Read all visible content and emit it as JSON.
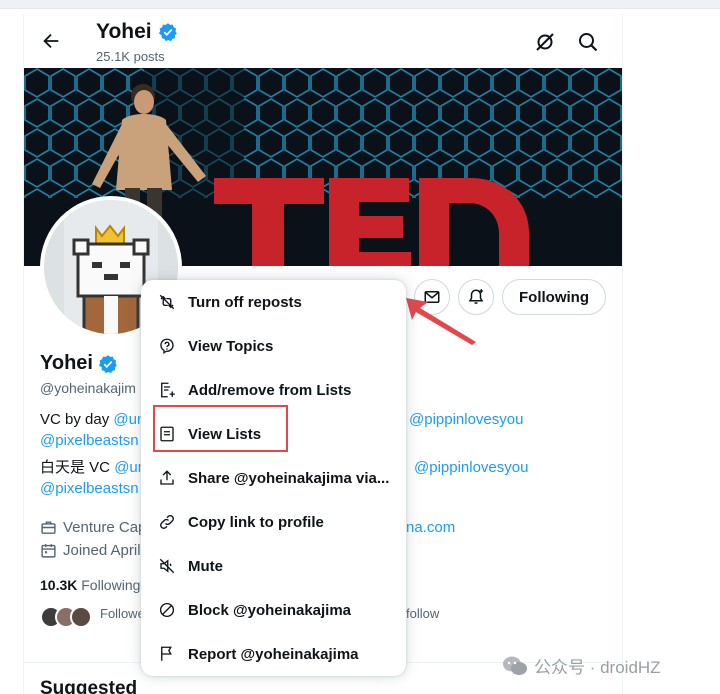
{
  "header": {
    "name": "Yohei",
    "posts": "25.1K posts"
  },
  "profile": {
    "name": "Yohei",
    "handle": "@yoheinakajim",
    "bio_en": {
      "prefix": "VC by day ",
      "link1": "@un",
      "link2": "@pippinlovesyou",
      "link3": "@pixelbeastsn"
    },
    "bio_ja": {
      "prefix": "白天是 VC ",
      "link1": "@un",
      "link2": "@pippinlovesyou",
      "link3": "@pixelbeastsn"
    },
    "work": "Venture Cap",
    "website": "na.com",
    "joined": "Joined April",
    "following_count": "10.3K",
    "following_label": "Following",
    "mutual_prefix": "Followe",
    "mutual_suffix": "follow"
  },
  "actions": {
    "following_label": "Following"
  },
  "menu": {
    "items": [
      {
        "label": "Turn off reposts",
        "icon": "repost-off-icon"
      },
      {
        "label": "View Topics",
        "icon": "topics-icon"
      },
      {
        "label": "Add/remove from Lists",
        "icon": "list-add-icon"
      },
      {
        "label": "View Lists",
        "icon": "list-icon"
      },
      {
        "label": "Share @yoheinakajima via...",
        "icon": "share-icon"
      },
      {
        "label": "Copy link to profile",
        "icon": "link-icon"
      },
      {
        "label": "Mute",
        "icon": "mute-icon"
      },
      {
        "label": "Block @yoheinakajima",
        "icon": "block-icon"
      },
      {
        "label": "Report @yoheinakajima",
        "icon": "flag-icon"
      }
    ]
  },
  "section": {
    "suggested": "Suggested"
  },
  "watermark": {
    "text": "公众号 · droidHZ"
  },
  "colors": {
    "accent": "#1d9bf0",
    "highlight": "#e2474b",
    "banner_red": "#c8232a"
  }
}
